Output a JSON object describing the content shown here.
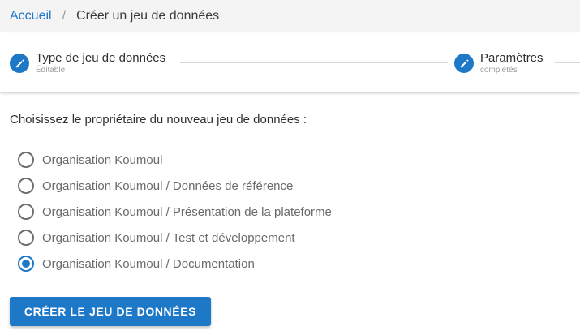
{
  "breadcrumb": {
    "home": "Accueil",
    "separator": "/",
    "current": "Créer un jeu de données"
  },
  "stepper": {
    "steps": [
      {
        "title": "Type de jeu de données",
        "subtitle": "Éditable",
        "icon": "pencil-icon"
      },
      {
        "title": "Paramètres",
        "subtitle": "complétés",
        "icon": "pencil-icon"
      }
    ]
  },
  "owner": {
    "prompt": "Choisissez le propriétaire du nouveau jeu de données :",
    "options": [
      {
        "label": "Organisation Koumoul",
        "selected": false
      },
      {
        "label": "Organisation Koumoul / Données de référence",
        "selected": false
      },
      {
        "label": "Organisation Koumoul / Présentation de la plateforme",
        "selected": false
      },
      {
        "label": "Organisation Koumoul / Test et développement",
        "selected": false
      },
      {
        "label": "Organisation Koumoul / Documentation",
        "selected": true
      }
    ]
  },
  "actions": {
    "create_label": "CRÉER LE JEU DE DONNÉES"
  },
  "colors": {
    "accent": "#1e78c8",
    "breadcrumb_bg": "#f4f4f4"
  }
}
